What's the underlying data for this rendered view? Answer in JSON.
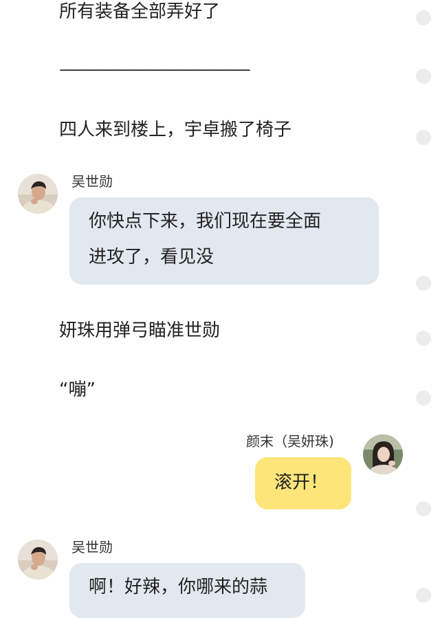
{
  "narration": [
    "所有装备全部弄好了",
    "————————————",
    "四人来到楼上，宇卓搬了椅子",
    "妍珠用弹弓瞄准世勋",
    "“嘣”"
  ],
  "messages": [
    {
      "sender": "吴世勋",
      "lines": [
        "你快点下来，我们现在要全面",
        "进攻了，看见没"
      ]
    },
    {
      "sender": "颜末（吴妍珠)",
      "lines": [
        "滚开！"
      ]
    },
    {
      "sender": "吴世勋",
      "lines": [
        "啊！好辣，你哪来的蒜"
      ]
    }
  ]
}
